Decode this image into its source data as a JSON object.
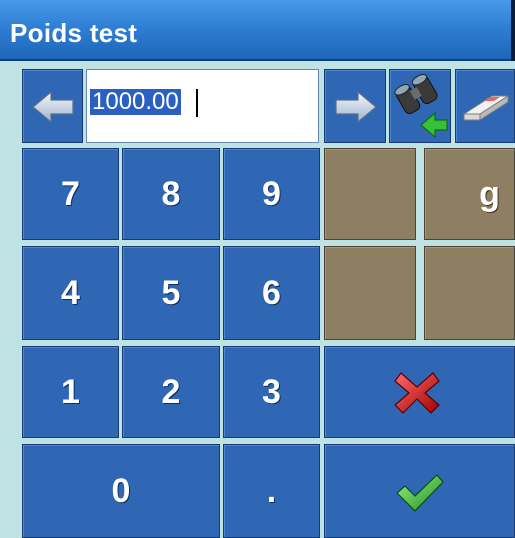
{
  "window": {
    "title": "Poids test"
  },
  "input": {
    "value": "1000.00"
  },
  "keypad": {
    "k7": "7",
    "k8": "8",
    "k9": "9",
    "k4": "4",
    "k5": "5",
    "k6": "6",
    "k1": "1",
    "k2": "2",
    "k3": "3",
    "k0": "0",
    "kdot": ".",
    "unit": "g"
  },
  "icons": {
    "left": "arrow-left-icon",
    "right": "arrow-right-icon",
    "lookup": "binoculars-icon",
    "clear": "eraser-icon",
    "cancel": "red-x-icon",
    "confirm": "green-check-icon"
  },
  "colors": {
    "background": "#bfe3e2",
    "key_blue": "#2f67b5",
    "key_tan": "#8e7f63",
    "title_bar": "#2f7fd6",
    "selection": "#2b5fc2"
  }
}
